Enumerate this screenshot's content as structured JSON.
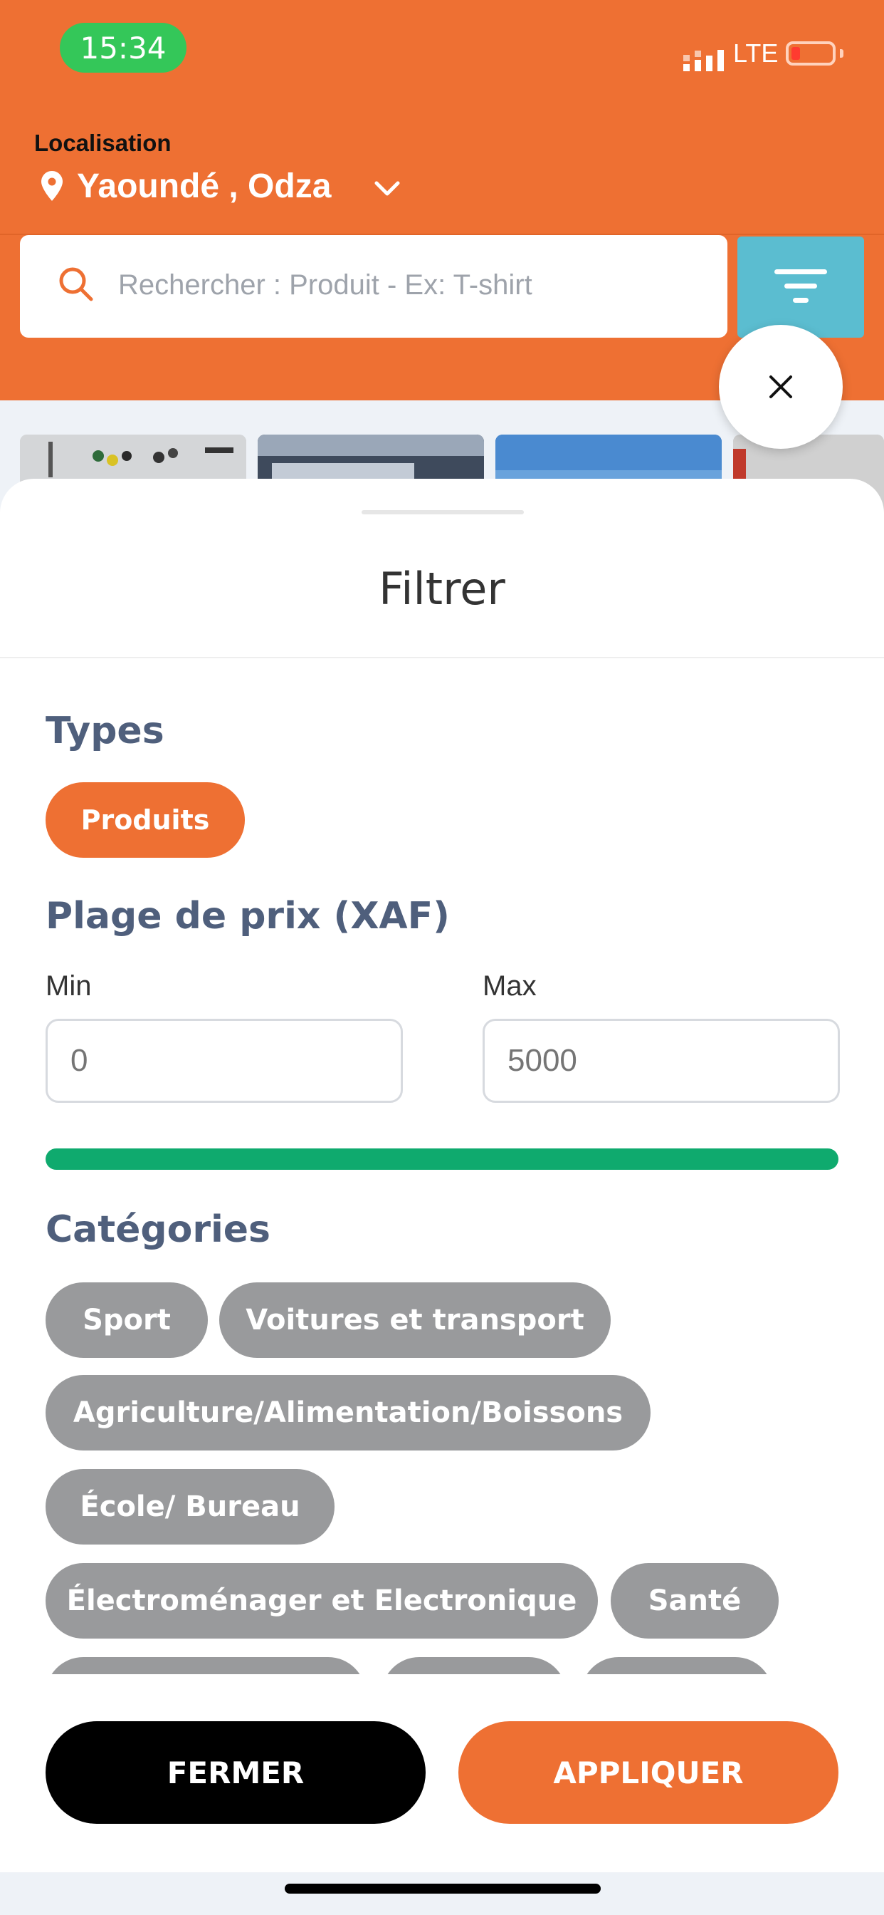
{
  "status_bar": {
    "time": "15:34",
    "network": "LTE"
  },
  "header": {
    "location_label": "Localisation",
    "location_value": "Yaoundé , Odza"
  },
  "search": {
    "placeholder": "Rechercher : Produit - Ex: T-shirt"
  },
  "filter_sheet": {
    "title": "Filtrer",
    "types_title": "Types",
    "type_chips": [
      "Produits"
    ],
    "price_title": "Plage de prix (XAF)",
    "min_label": "Min",
    "max_label": "Max",
    "min_placeholder": "0",
    "max_placeholder": "5000",
    "categories_title": "Catégories",
    "categories": [
      "Sport",
      "Voitures et transport",
      "Agriculture/Alimentation/Boissons",
      "École/ Bureau",
      "Électroménager et Electronique",
      "Santé"
    ],
    "close_label": "FERMER",
    "apply_label": "APPLIQUER"
  },
  "colors": {
    "brand_orange": "#ee7033",
    "filter_button": "#5bbdd0",
    "range_green": "#0faa6e",
    "chip_gray": "#999a9c",
    "section_title": "#4f5f7c"
  },
  "icons": [
    "map-pin-icon",
    "chevron-down-icon",
    "search-icon",
    "filter-icon",
    "close-icon",
    "battery-icon",
    "signal-icon"
  ]
}
